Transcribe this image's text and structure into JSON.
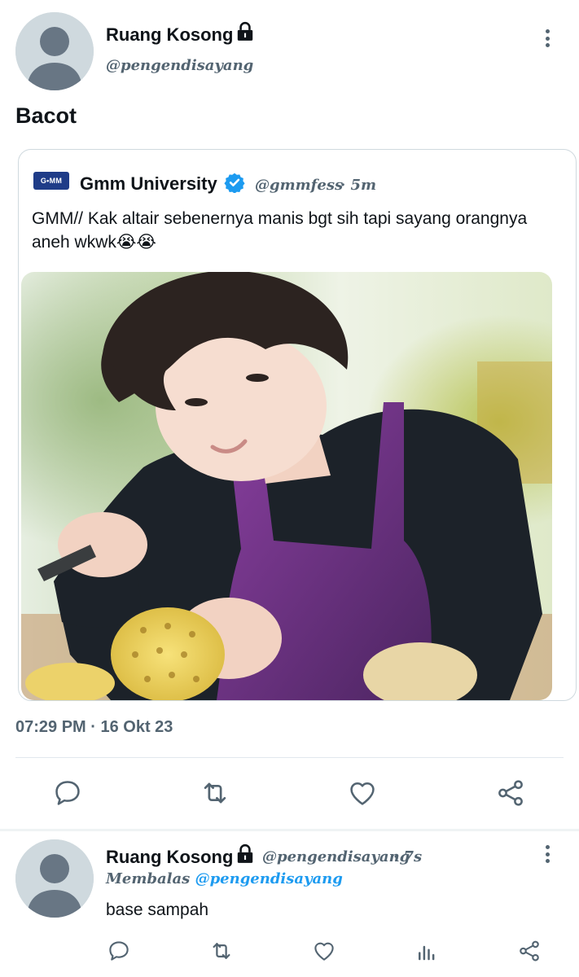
{
  "main_tweet": {
    "author_name": "Ruang Kosong",
    "author_handle": "@pengendisayang",
    "text": "Bacot",
    "timestamp": "07:29 PM · 16 Okt 23"
  },
  "quoted_tweet": {
    "logo_text": "G•MM",
    "author_name": "Gmm University",
    "author_handle": "@gmmfess",
    "time_ago": "· 5m",
    "text": "GMM// Kak altair sebenernya manis bgt sih tapi sayang orangnya aneh wkwk😭😭",
    "verified": true
  },
  "reply": {
    "author_name": "Ruang Kosong",
    "author_handle": "@pengendisayang",
    "time_ago": "· 7s",
    "replying_prefix": "Membalas",
    "replying_to": "@pengendisayang",
    "text": "base sampah"
  },
  "colors": {
    "accent_blue": "#1d9bf0",
    "secondary_text": "#536471",
    "border": "#cfd9de"
  },
  "icons": {
    "lock": "lock-icon",
    "reply": "reply-icon",
    "retweet": "retweet-icon",
    "like": "like-icon",
    "share": "share-icon",
    "views": "views-icon",
    "more": "more-icon",
    "verified": "verified-badge-icon"
  }
}
